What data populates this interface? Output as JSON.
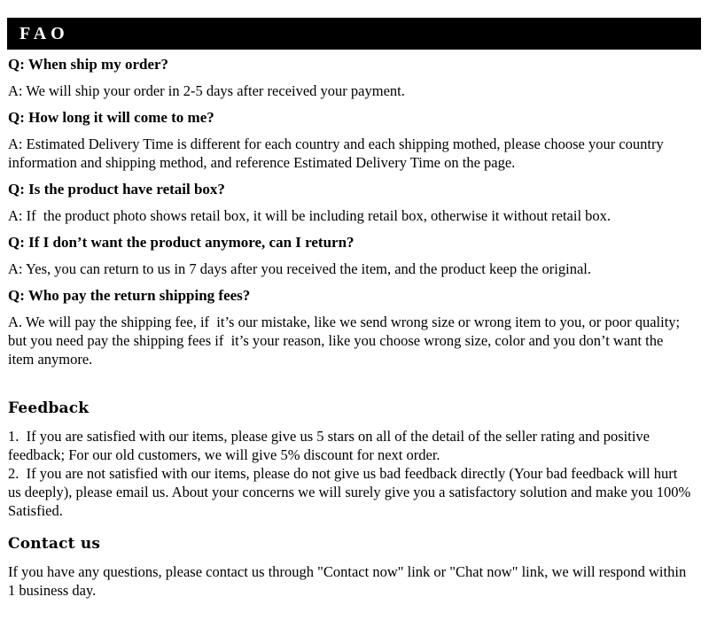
{
  "document": {
    "background_color": "#ffffff",
    "text_color": "#000000",
    "banner_color": "#000000",
    "banner_text_color": "#ffffff"
  },
  "header": {
    "title": "FAO"
  },
  "faq": {
    "items": [
      {
        "question": "Q: When ship my order?",
        "answer": "A: We will ship your order in 2-5 days after received your payment."
      },
      {
        "question": "Q: How long it will come to me?",
        "answer": "A: Estimated Delivery Time is different for each country and each shipping mothed, please choose your country information and shipping method, and reference Estimated Delivery Time on the page."
      },
      {
        "question": "Q: Is the product have retail box?",
        "answer": "A: If  the product photo shows retail box, it will be including retail box, otherwise it without retail box."
      },
      {
        "question": "Q: If I don’t want the product anymore, can I return?",
        "answer": "A: Yes, you can return to us in 7 days after you received the item, and the product keep the original."
      },
      {
        "question": "Q: Who pay the return shipping fees?",
        "answer": "A. We will pay the shipping fee, if  it’s our mistake, like we send wrong size or wrong item to you, or poor quality; but you need pay the shipping fees if  it’s your reason, like you choose wrong size, color and you don’t want the item anymore."
      }
    ]
  },
  "feedback": {
    "heading": "Feedback",
    "item_1": "1.  If you are satisfied with our items, please give us 5 stars on all of the detail of the seller rating and positive feedback; For our old customers, we will give 5% discount for next order.",
    "item_2": "2.  If you are not satisfied with our items, please do not give us bad feedback directly (Your bad feedback will hurt us deeply), please email us. About your concerns we will surely give you a satisfactory solution and make you 100% Satisfied."
  },
  "contact": {
    "heading": "Contact us",
    "body": "If you have any questions, please contact us through \"Contact now\" link or \"Chat now\" link, we will respond within 1 business day."
  }
}
